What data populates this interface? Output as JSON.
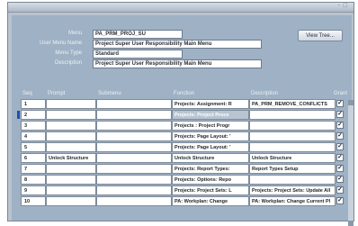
{
  "window": {
    "controls": "‐ □"
  },
  "header": {
    "menu_label": "Menu",
    "menu_value": "PA_PRM_PROJ_SU",
    "user_menu_name_label": "User Menu Name",
    "user_menu_name_value": "Project Super User Responsibility Main Menu",
    "menu_type_label": "Menu Type",
    "menu_type_value": "Standard",
    "description_label": "Description",
    "description_value": "Project Super User Responsibility Main Menu",
    "view_tree_label": "View Tree..."
  },
  "columns": {
    "seq": "Seq",
    "prompt": "Prompt",
    "submenu": "Submenu",
    "function": "Function",
    "description": "Description",
    "grant": "Grant"
  },
  "rows": [
    {
      "seq": "1",
      "prompt": "",
      "submenu": "",
      "function": "Projects: Assignment: R",
      "description": "PA_PRM_REMOVE_CONFLICTS",
      "grant": "✓"
    },
    {
      "seq": "2",
      "prompt": "",
      "submenu": "",
      "function": "Projects: Project Proce",
      "description": "",
      "grant": "✓"
    },
    {
      "seq": "3",
      "prompt": "",
      "submenu": "",
      "function": "Projects : Project Progr",
      "description": "",
      "grant": "✓"
    },
    {
      "seq": "4",
      "prompt": "",
      "submenu": "",
      "function": "Projects: Page Layout: '",
      "description": "",
      "grant": "✓"
    },
    {
      "seq": "5",
      "prompt": "",
      "submenu": "",
      "function": "Projects: Page Layout: '",
      "description": "",
      "grant": "✓"
    },
    {
      "seq": "6",
      "prompt": "Unlock Structure",
      "submenu": "",
      "function": "Unlock Structure",
      "description": "Unlock Structure",
      "grant": "✓"
    },
    {
      "seq": "7",
      "prompt": "",
      "submenu": "",
      "function": "Projects: Report Types:",
      "description": "Report Types Setup",
      "grant": "✓"
    },
    {
      "seq": "8",
      "prompt": "",
      "submenu": "",
      "function": "Projects: Options: Repo",
      "description": "",
      "grant": "✓"
    },
    {
      "seq": "9",
      "prompt": "",
      "submenu": "",
      "function": "Projects: Project Sets: L",
      "description": "Projects: Project Sets: Update All",
      "grant": "✓"
    },
    {
      "seq": "10",
      "prompt": "",
      "submenu": "",
      "function": "PA: Workplan: Change",
      "description": "PA: Workplan: Change Current Pl",
      "grant": "✓"
    }
  ],
  "colors": {
    "panel": "#9fb1c4",
    "frame": "#b9c3cf",
    "cursor": "#1e4fb5"
  }
}
